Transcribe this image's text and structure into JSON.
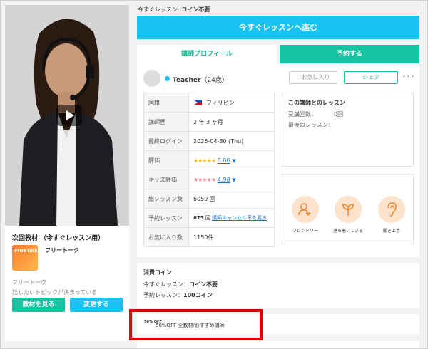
{
  "next_material": {
    "title": "次回教材 （今すぐレッスン用）",
    "thumb_label": "FreeTalk",
    "name": "フリートーク",
    "category": "フリートーク",
    "description": "話したいトピックが決まっている",
    "view_button": "教材を見る",
    "change_button": "変更する"
  },
  "header": {
    "now_label": "今すぐレッスン:",
    "now_value": "コイン不要",
    "proceed_button": "今すぐレッスンへ進む"
  },
  "tabs": {
    "profile": "講師プロフィール",
    "book": "予約する"
  },
  "teacher": {
    "name": "Teacher",
    "age": "（24歳）",
    "favorite_button": "お気に入り",
    "share_button": "シェア",
    "more_button": "･･･"
  },
  "info": {
    "nationality_label": "国籍",
    "nationality_value": "フィリピン",
    "experience_label": "講師歴",
    "experience_value": "2 年 3 ヶ月",
    "last_login_label": "最終ログイン",
    "last_login_value": "2026-04-30 (Thu)",
    "rating_label": "評価",
    "rating_value": "5.00",
    "kids_rating_label": "キッズ評価",
    "kids_rating_value": "4.98",
    "total_lessons_label": "総レッスン数",
    "total_lessons_value": "6059 回",
    "reservation_label": "予約レッスン",
    "reservation_value": "875",
    "reservation_unit": "回",
    "reservation_link": "講師キャンセル率を見る",
    "favorites_label": "お気に入り数",
    "favorites_value": "1150件"
  },
  "lesson_with_teacher": {
    "title": "この講師とのレッスン",
    "count_label": "受講回数：",
    "count_value": "0回",
    "last_label": "最後のレッスン："
  },
  "traits": [
    {
      "label": "フレンドリー",
      "icon": "friendly-icon"
    },
    {
      "label": "落ち着いている",
      "icon": "calm-icon"
    },
    {
      "label": "聞き上手",
      "icon": "good-listener-icon"
    }
  ],
  "coins": {
    "title": "消費コイン",
    "now_label": "今すぐレッスン：",
    "now_value": "コイン不要",
    "reserve_label": "予約レッスン：",
    "reserve_value": "100コイン"
  },
  "promo": {
    "badge": "50% OFF",
    "text": "50%OFF 全教材/おすすめ講師"
  },
  "colors": {
    "primary_blue": "#19c2f0",
    "primary_green": "#17c3a0",
    "highlight_red": "#e00000",
    "trait_bg": "#fde3cc"
  }
}
